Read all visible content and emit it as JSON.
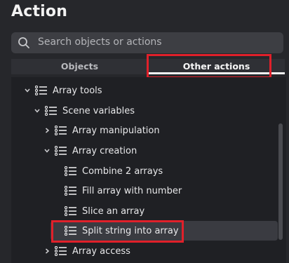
{
  "title": "Action",
  "search": {
    "placeholder": "Search objects or actions",
    "icon": "search-icon"
  },
  "tabs": [
    {
      "label": "Objects",
      "active": false
    },
    {
      "label": "Other actions",
      "active": true
    }
  ],
  "tree": {
    "items": [
      {
        "label": "Array tools",
        "expanded": true,
        "level": 0
      },
      {
        "label": "Scene variables",
        "expanded": true,
        "level": 1
      },
      {
        "label": "Array manipulation",
        "expanded": false,
        "level": 2
      },
      {
        "label": "Array creation",
        "expanded": true,
        "level": 2
      },
      {
        "label": "Combine 2 arrays",
        "level": 3
      },
      {
        "label": "Fill array with number",
        "level": 3
      },
      {
        "label": "Slice an array",
        "level": 3
      },
      {
        "label": "Split string into array",
        "level": 3,
        "selected": true
      },
      {
        "label": "Array access",
        "expanded": false,
        "level": 2
      }
    ]
  },
  "colors": {
    "background": "#26272b",
    "tree_background": "#1f2024",
    "highlight": "#e0202a",
    "selected_row": "#3a3b41"
  }
}
